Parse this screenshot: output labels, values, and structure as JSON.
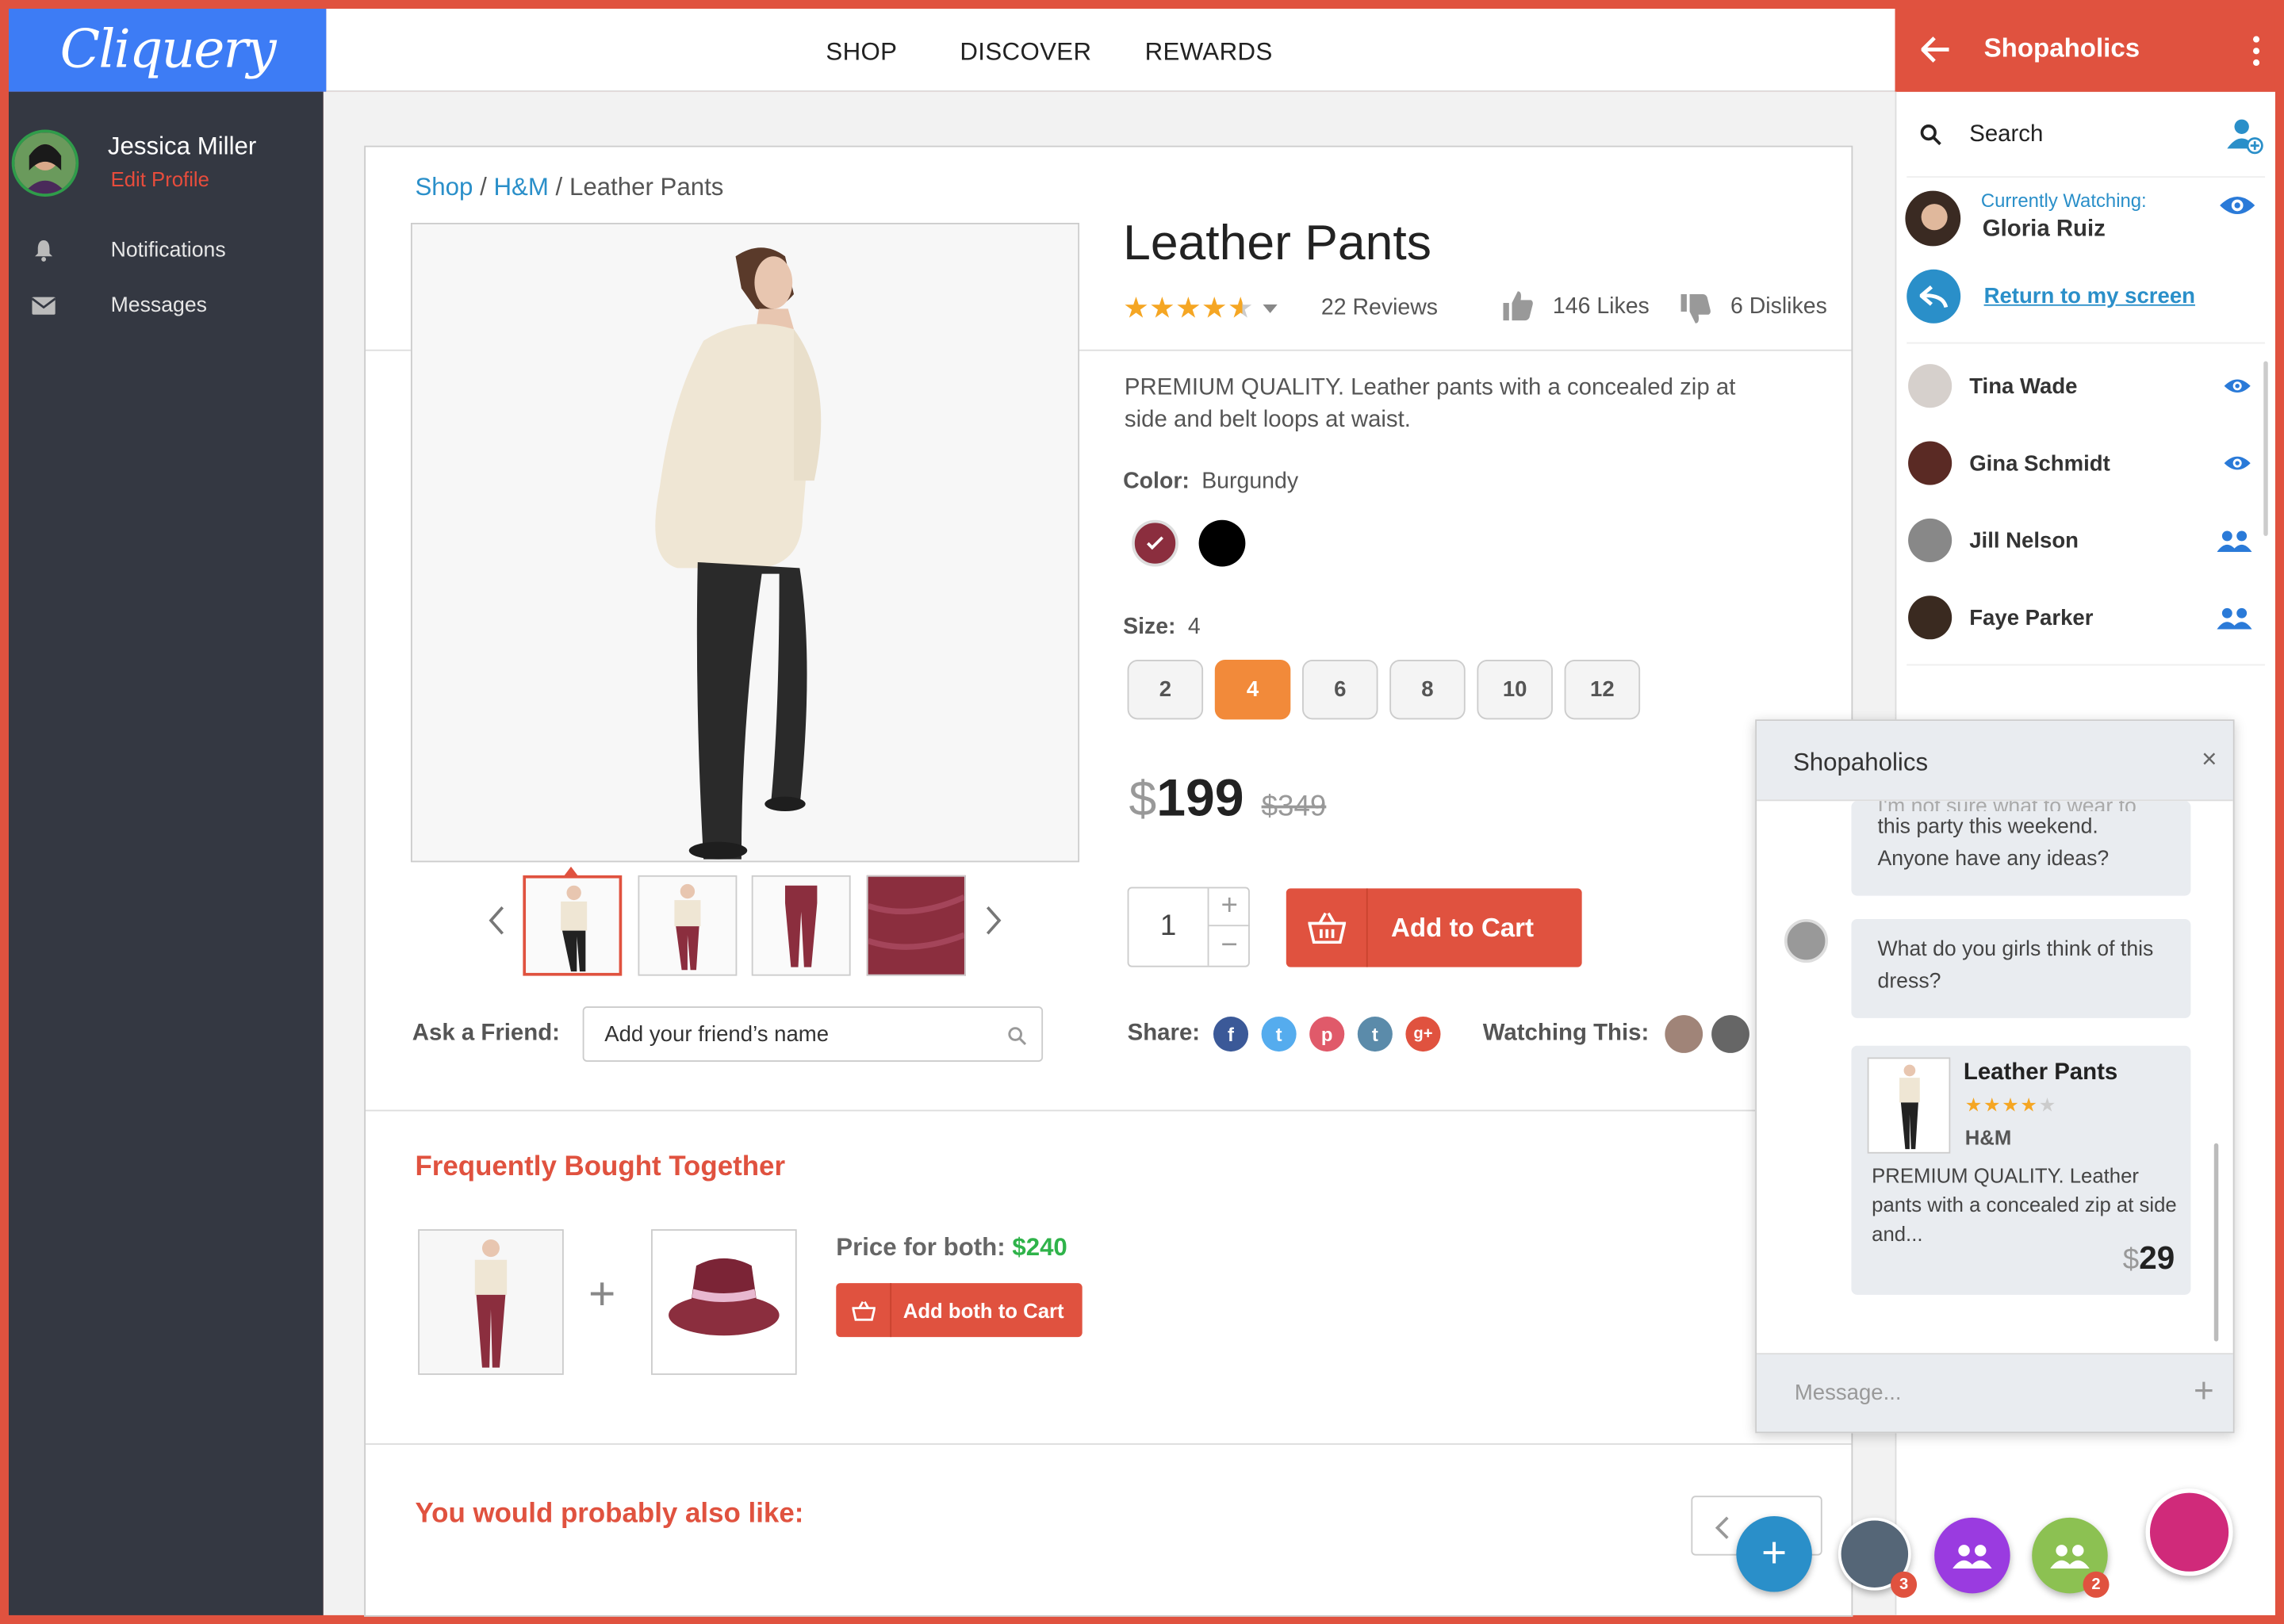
{
  "brand": {
    "logo_text": "Cliquery",
    "accent_color": "#e0523f",
    "logo_bg": "#3d7cf5"
  },
  "nav": {
    "items": [
      "SHOP",
      "DISCOVER",
      "REWARDS"
    ]
  },
  "sidebar": {
    "user_name": "Jessica Miller",
    "edit_profile": "Edit Profile",
    "items": [
      {
        "label": "Notifications",
        "icon": "bell-icon"
      },
      {
        "label": "Messages",
        "icon": "envelope-icon"
      }
    ]
  },
  "breadcrumb": {
    "shop": "Shop",
    "brand": "H&M",
    "current": "Leather Pants",
    "sep": "/"
  },
  "product": {
    "title": "Leather Pants",
    "rating": 4.5,
    "reviews": "22 Reviews",
    "likes": "146 Likes",
    "dislikes": "6 Dislikes",
    "description": "PREMIUM QUALITY. Leather pants with a concealed zip at side and belt loops at waist.",
    "color_label": "Color:",
    "color_value": "Burgundy",
    "colors": [
      "#8b2e3e",
      "#000000"
    ],
    "size_label": "Size:",
    "size_value": "4",
    "sizes": [
      "2",
      "4",
      "6",
      "8",
      "10",
      "12"
    ],
    "selected_size": "4",
    "currency": "$",
    "price": "199",
    "old_price": "$349",
    "quantity": "1",
    "add_to_cart": "Add to Cart"
  },
  "ask_friend": {
    "label": "Ask a Friend:",
    "placeholder": "Add your friend’s name"
  },
  "share": {
    "label": "Share:",
    "watching_label": "Watching This:"
  },
  "bought_together": {
    "title": "Frequently Bought Together",
    "price_label": "Price for both:",
    "price": "$240",
    "button": "Add both to Cart"
  },
  "also_like": {
    "title": "You would probably also like:"
  },
  "right_panel": {
    "title": "Shopaholics",
    "search_label": "Search",
    "currently_watching_label": "Currently Watching:",
    "currently_watching_name": "Gloria Ruiz",
    "return_link": "Return to my screen",
    "friends": [
      {
        "name": "Tina Wade",
        "status_icon": "eye-icon"
      },
      {
        "name": "Gina Schmidt",
        "status_icon": "eye-icon"
      },
      {
        "name": "Jill Nelson",
        "status_icon": "group-icon"
      },
      {
        "name": "Faye Parker",
        "status_icon": "group-icon"
      }
    ]
  },
  "chat": {
    "title": "Shopaholics",
    "msg1_partial": "I'm not sure what to wear to",
    "msg1_rest": "this party this weekend. Anyone have any ideas?",
    "msg2": "What do you girls think of this dress?",
    "card_title": "Leather Pants",
    "card_brand": "H&M",
    "card_desc": "PREMIUM QUALITY. Leather pants with a concealed zip at side and...",
    "card_currency": "$",
    "card_price": "29",
    "message_placeholder": "Message..."
  },
  "fabs": {
    "badge_1": "3",
    "badge_2": "2"
  }
}
